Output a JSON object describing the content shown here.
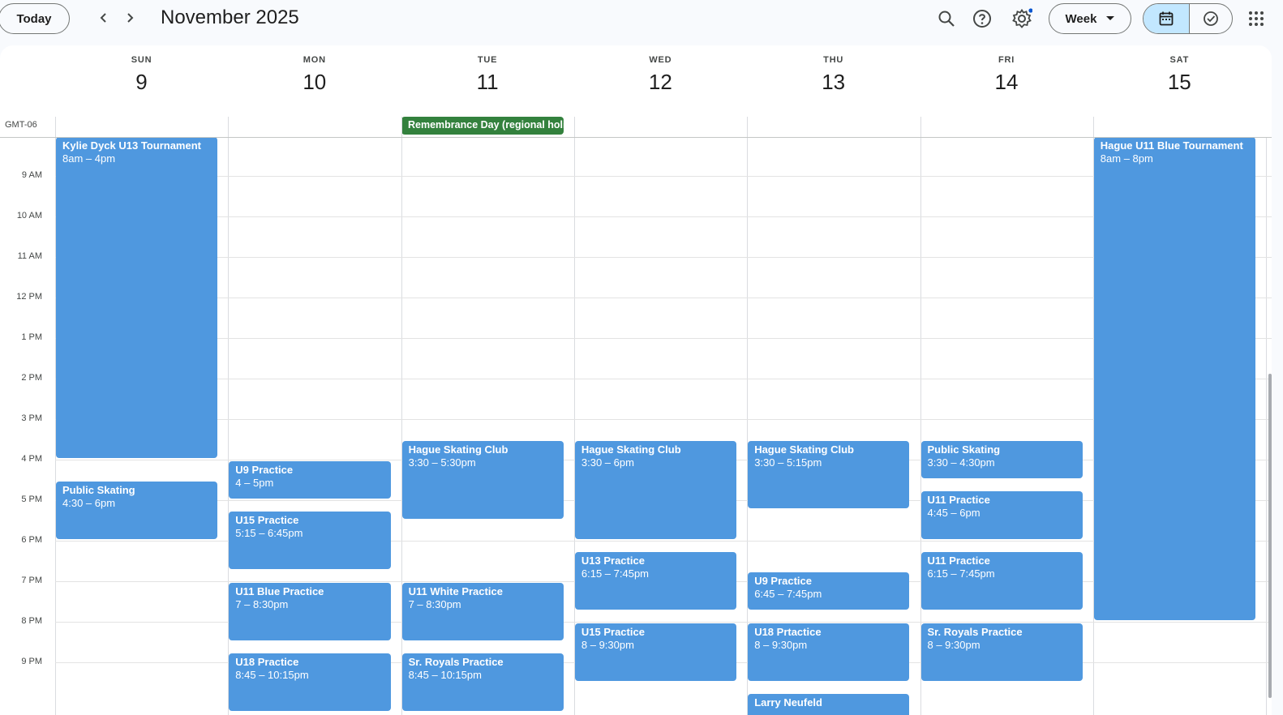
{
  "toolbar": {
    "today_label": "Today",
    "month_title": "November 2025",
    "view_label": "Week"
  },
  "timezone": "GMT-06",
  "days": [
    {
      "name": "SUN",
      "num": "9"
    },
    {
      "name": "MON",
      "num": "10"
    },
    {
      "name": "TUE",
      "num": "11"
    },
    {
      "name": "WED",
      "num": "12"
    },
    {
      "name": "THU",
      "num": "13"
    },
    {
      "name": "FRI",
      "num": "14"
    },
    {
      "name": "SAT",
      "num": "15"
    }
  ],
  "hours": [
    "9 AM",
    "10 AM",
    "11 AM",
    "12 PM",
    "1 PM",
    "2 PM",
    "3 PM",
    "4 PM",
    "5 PM",
    "6 PM",
    "7 PM",
    "8 PM",
    "9 PM"
  ],
  "all_day": {
    "day": "11",
    "title": "Remembrance Day (regional holiday)",
    "color": "#33813d"
  },
  "event_color": "#4f98df",
  "events": [
    {
      "day": 0,
      "title": "Kylie Dyck U13 Tournament",
      "time": "8am – 4pm",
      "start": 8,
      "end": 16
    },
    {
      "day": 0,
      "title": "Public Skating",
      "time": "4:30 – 6pm",
      "start": 16.5,
      "end": 18
    },
    {
      "day": 1,
      "title": "U9 Practice",
      "time": "4 – 5pm",
      "start": 16,
      "end": 17
    },
    {
      "day": 1,
      "title": "U15 Practice",
      "time": "5:15 – 6:45pm",
      "start": 17.25,
      "end": 18.75
    },
    {
      "day": 1,
      "title": "U11 Blue Practice",
      "time": "7 – 8:30pm",
      "start": 19,
      "end": 20.5
    },
    {
      "day": 1,
      "title": "U18 Practice",
      "time": "8:45 – 10:15pm",
      "start": 20.75,
      "end": 22.25
    },
    {
      "day": 2,
      "title": "Hague Skating Club",
      "time": "3:30 – 5:30pm",
      "start": 15.5,
      "end": 17.5
    },
    {
      "day": 2,
      "title": "U11 White Practice",
      "time": "7 – 8:30pm",
      "start": 19,
      "end": 20.5
    },
    {
      "day": 2,
      "title": "Sr. Royals Practice",
      "time": "8:45 – 10:15pm",
      "start": 20.75,
      "end": 22.25
    },
    {
      "day": 3,
      "title": "Hague Skating Club",
      "time": "3:30 – 6pm",
      "start": 15.5,
      "end": 18
    },
    {
      "day": 3,
      "title": "U13 Practice",
      "time": "6:15 – 7:45pm",
      "start": 18.25,
      "end": 19.75
    },
    {
      "day": 3,
      "title": "U15 Practice",
      "time": "8 – 9:30pm",
      "start": 20,
      "end": 21.5
    },
    {
      "day": 4,
      "title": "Hague Skating Club",
      "time": "3:30 – 5:15pm",
      "start": 15.5,
      "end": 17.25
    },
    {
      "day": 4,
      "title": "U9 Practice",
      "time": "6:45 – 7:45pm",
      "start": 18.75,
      "end": 19.75
    },
    {
      "day": 4,
      "title": "U18 Prtactice",
      "time": "8 – 9:30pm",
      "start": 20,
      "end": 21.5
    },
    {
      "day": 4,
      "title": "Larry Neufeld",
      "time": "",
      "start": 21.75,
      "end": 22.5
    },
    {
      "day": 5,
      "title": "Public Skating",
      "time": "3:30 – 4:30pm",
      "start": 15.5,
      "end": 16.5
    },
    {
      "day": 5,
      "title": "U11 Practice",
      "time": "4:45 – 6pm",
      "start": 16.75,
      "end": 18
    },
    {
      "day": 5,
      "title": "U11 Practice",
      "time": "6:15 – 7:45pm",
      "start": 18.25,
      "end": 19.75
    },
    {
      "day": 5,
      "title": "Sr. Royals Practice",
      "time": "8 – 9:30pm",
      "start": 20,
      "end": 21.5
    },
    {
      "day": 6,
      "title": "Hague U11 Blue Tournament",
      "time": "8am – 8pm",
      "start": 8,
      "end": 20
    }
  ]
}
